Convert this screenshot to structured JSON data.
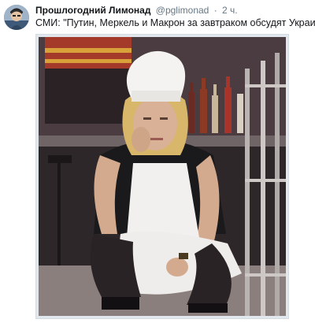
{
  "tweet": {
    "display_name": "Прошлогодний Лимонад",
    "handle": "@pglimonad",
    "separator": "·",
    "time": "2 ч.",
    "text": "СМИ: \"Путин, Меркель и Макрон за завтраком обсудят Украину\"",
    "avatar_icon": "user-avatar",
    "photo_icon": "attached-photo"
  },
  "colors": {
    "name": "#14171a",
    "secondary": "#657786",
    "media_border": "#d5dbe0"
  }
}
